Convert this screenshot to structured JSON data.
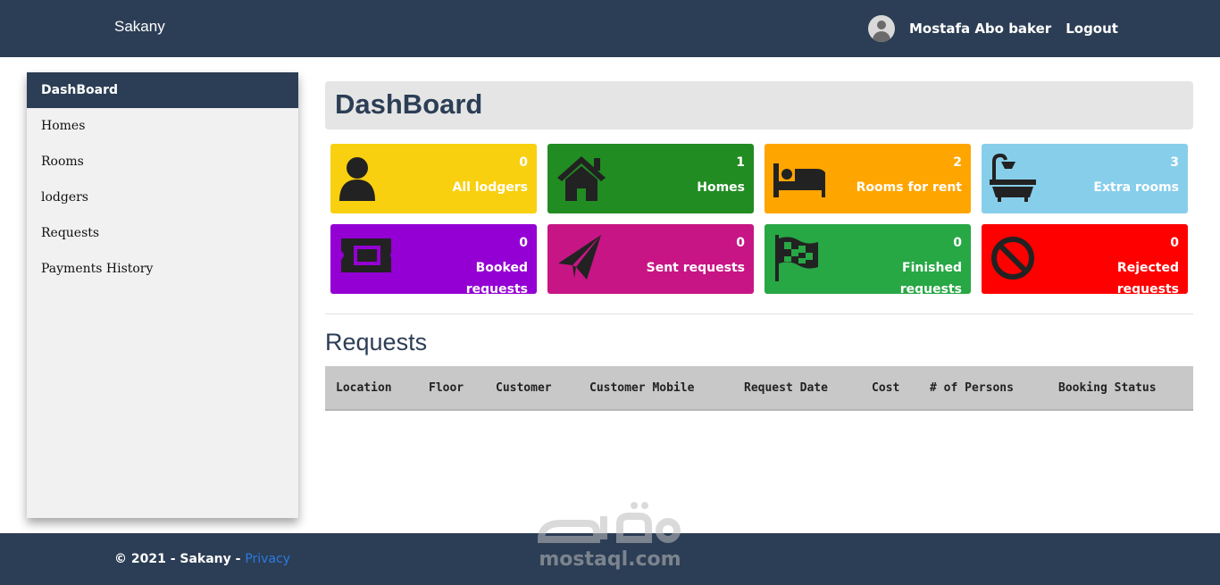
{
  "navbar": {
    "brand": "Sakany",
    "user_name": "Mostafa Abo baker",
    "logout_label": "Logout"
  },
  "sidebar": {
    "items": [
      {
        "label": "DashBoard",
        "active": true
      },
      {
        "label": "Homes"
      },
      {
        "label": "Rooms"
      },
      {
        "label": "lodgers"
      },
      {
        "label": "Requests"
      },
      {
        "label": "Payments History"
      }
    ]
  },
  "main": {
    "title": "DashBoard",
    "cards": [
      {
        "count": "0",
        "label": "All lodgers",
        "color": "#f9d00f",
        "icon": "user-icon"
      },
      {
        "count": "1",
        "label": "Homes",
        "color": "#218c22",
        "icon": "home-icon"
      },
      {
        "count": "2",
        "label": "Rooms for rent",
        "color": "#ffa500",
        "icon": "bed-icon"
      },
      {
        "count": "3",
        "label": "Extra rooms",
        "color": "#87ceeb",
        "icon": "bath-icon"
      },
      {
        "count": "0",
        "label": "Booked requests",
        "color": "#9400d3",
        "icon": "ticket-icon"
      },
      {
        "count": "0",
        "label": "Sent requests",
        "color": "#c71585",
        "icon": "paper-plane-icon"
      },
      {
        "count": "0",
        "label": "Finished requests",
        "color": "#28a745",
        "icon": "flag-checkered-icon"
      },
      {
        "count": "0",
        "label": "Rejected requests",
        "color": "#ff0000",
        "icon": "ban-icon"
      }
    ],
    "requests_title": "Requests",
    "table_headers": [
      "Location",
      "Floor",
      "Customer",
      "Customer Mobile",
      "Request Date",
      "Cost",
      "# of Persons",
      "Booking Status"
    ]
  },
  "footer": {
    "copyright": "© 2021 - Sakany - ",
    "privacy_label": "Privacy"
  },
  "watermark": {
    "text": "mostaql.com"
  },
  "colors": {
    "nav_bg": "#2c3e55",
    "sidebar_bg": "#f1f1f1",
    "link": "#2a7ae2"
  }
}
